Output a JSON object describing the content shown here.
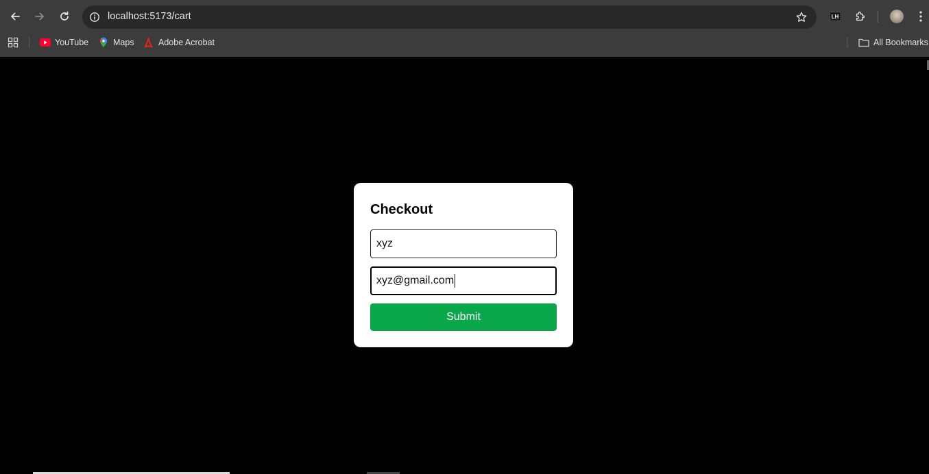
{
  "browser": {
    "url": "localhost:5173/cart",
    "bookmarks": [
      {
        "label": "YouTube",
        "icon": "youtube-icon"
      },
      {
        "label": "Maps",
        "icon": "maps-icon"
      },
      {
        "label": "Adobe Acrobat",
        "icon": "acrobat-icon"
      }
    ],
    "all_bookmarks_label": "All Bookmarks",
    "extension_badge": "LH"
  },
  "checkout": {
    "title": "Checkout",
    "name_value": "xyz",
    "email_value": "xyz@gmail.com",
    "submit_label": "Submit"
  },
  "colors": {
    "submit_green": "#0aa84a",
    "page_bg": "#000000",
    "chrome_bg": "#3c3c3c"
  }
}
